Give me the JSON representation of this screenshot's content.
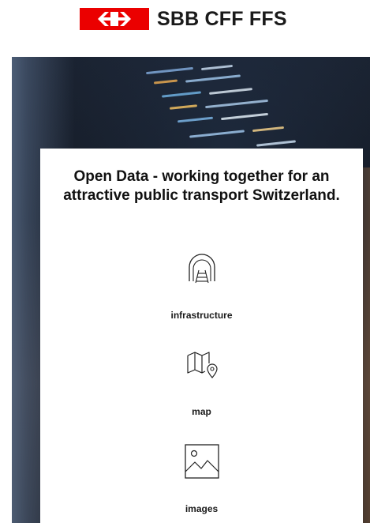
{
  "header": {
    "brand_text": "SBB CFF FFS",
    "brand_color": "#eb0000"
  },
  "hero": {
    "background": "keyboard-and-code-screen-photo"
  },
  "card": {
    "title": "Open Data - working together for an attractive public transport Switzerland.",
    "tiles": [
      {
        "label": "infrastructure",
        "icon": "tunnel-rail-icon"
      },
      {
        "label": "map",
        "icon": "map-pin-icon"
      },
      {
        "label": "images",
        "icon": "image-icon"
      }
    ]
  }
}
